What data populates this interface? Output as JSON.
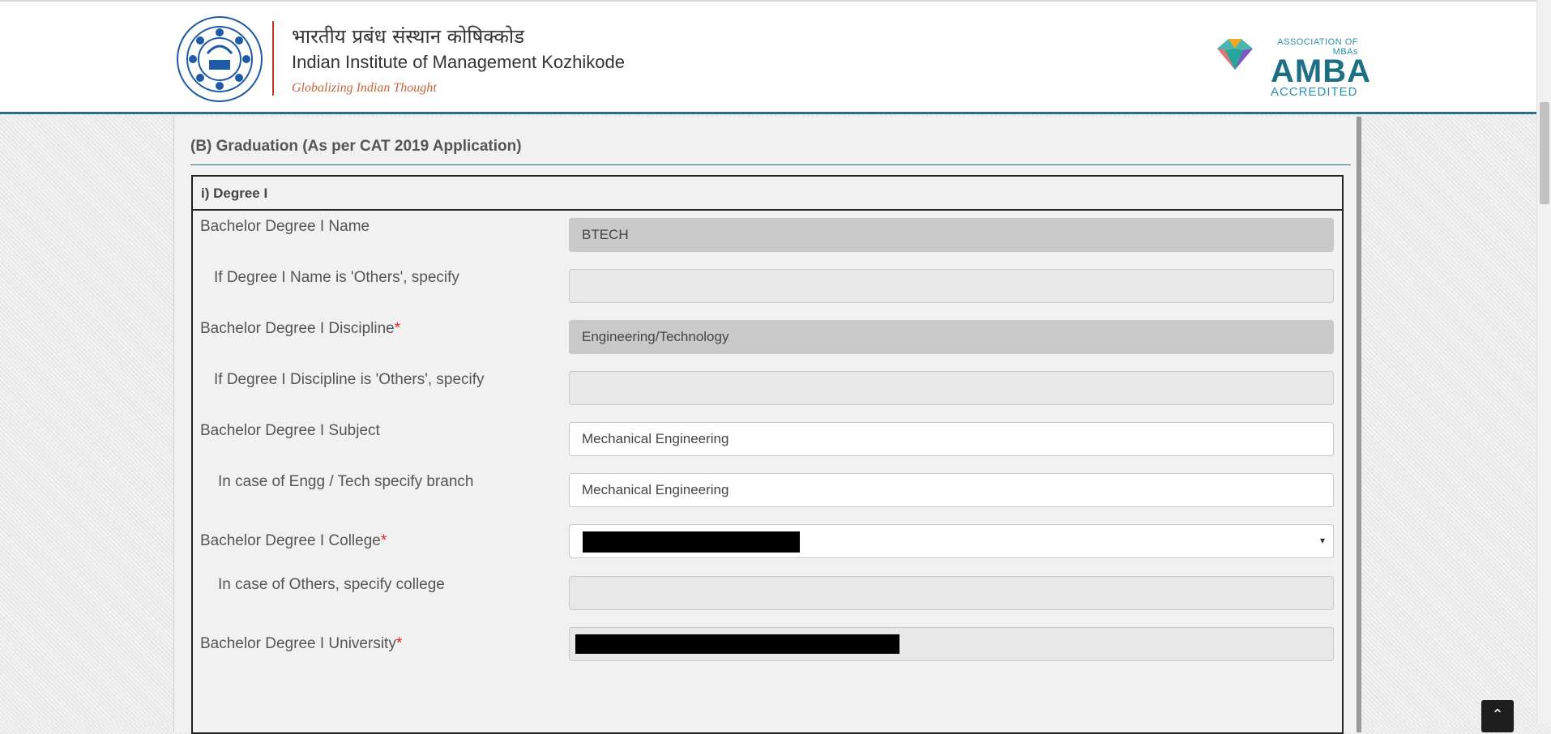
{
  "header": {
    "title_hindi": "भारतीय प्रबंध संस्थान कोषिक्कोड",
    "title_en": "Indian Institute of Management Kozhikode",
    "tagline": "Globalizing Indian Thought",
    "amba_small": "ASSOCIATION OF MBAs",
    "amba_big": "AMBA",
    "amba_accredited": "ACCREDITED"
  },
  "section": {
    "title": "(B) Graduation (As per CAT 2019 Application)",
    "degree_title": "i) Degree I"
  },
  "fields": {
    "degree_name": {
      "label": "Bachelor Degree I Name",
      "value": "BTECH"
    },
    "degree_name_other": {
      "label": "If Degree I Name is 'Others', specify",
      "value": ""
    },
    "discipline": {
      "label": "Bachelor Degree I Discipline",
      "required": "*",
      "value": "Engineering/Technology"
    },
    "discipline_other": {
      "label": "If Degree I Discipline is 'Others', specify",
      "value": ""
    },
    "subject": {
      "label": "Bachelor Degree I Subject",
      "value": "Mechanical Engineering"
    },
    "branch": {
      "label": "In case of Engg / Tech specify branch",
      "value": "Mechanical Engineering"
    },
    "college": {
      "label": "Bachelor Degree I College",
      "required": "*",
      "caret": "▾"
    },
    "college_other": {
      "label": "In case of Others, specify college",
      "value": ""
    },
    "university": {
      "label": "Bachelor Degree I University",
      "required": "*"
    }
  },
  "icons": {
    "scroll_top": "chevron-up-icon",
    "scroll_top_glyph": "⌃"
  },
  "colors": {
    "accent": "#2a6e8e",
    "required": "#e02020",
    "tagline": "#c9633a"
  }
}
